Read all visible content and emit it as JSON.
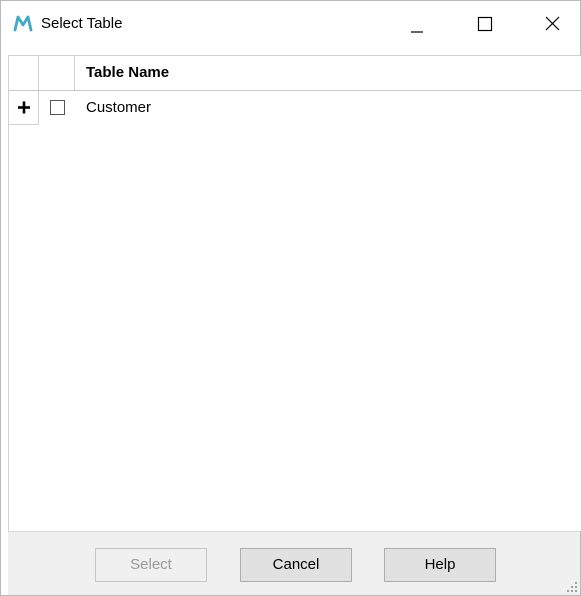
{
  "window": {
    "title": "Select Table",
    "icon": "m-logo-icon",
    "controls": [
      "minimize-icon",
      "maximize-icon",
      "close-icon"
    ]
  },
  "grid": {
    "columns": [
      "",
      "",
      "Table Name"
    ],
    "rows": [
      {
        "expand": "+",
        "checked": false,
        "name": "Customer"
      }
    ]
  },
  "footer": {
    "select_label": "Select",
    "cancel_label": "Cancel",
    "help_label": "Help"
  },
  "colors": {
    "accent": "#3fa9c9",
    "footer_bg": "#f0f0f0",
    "button_bg": "#e1e1e1"
  }
}
